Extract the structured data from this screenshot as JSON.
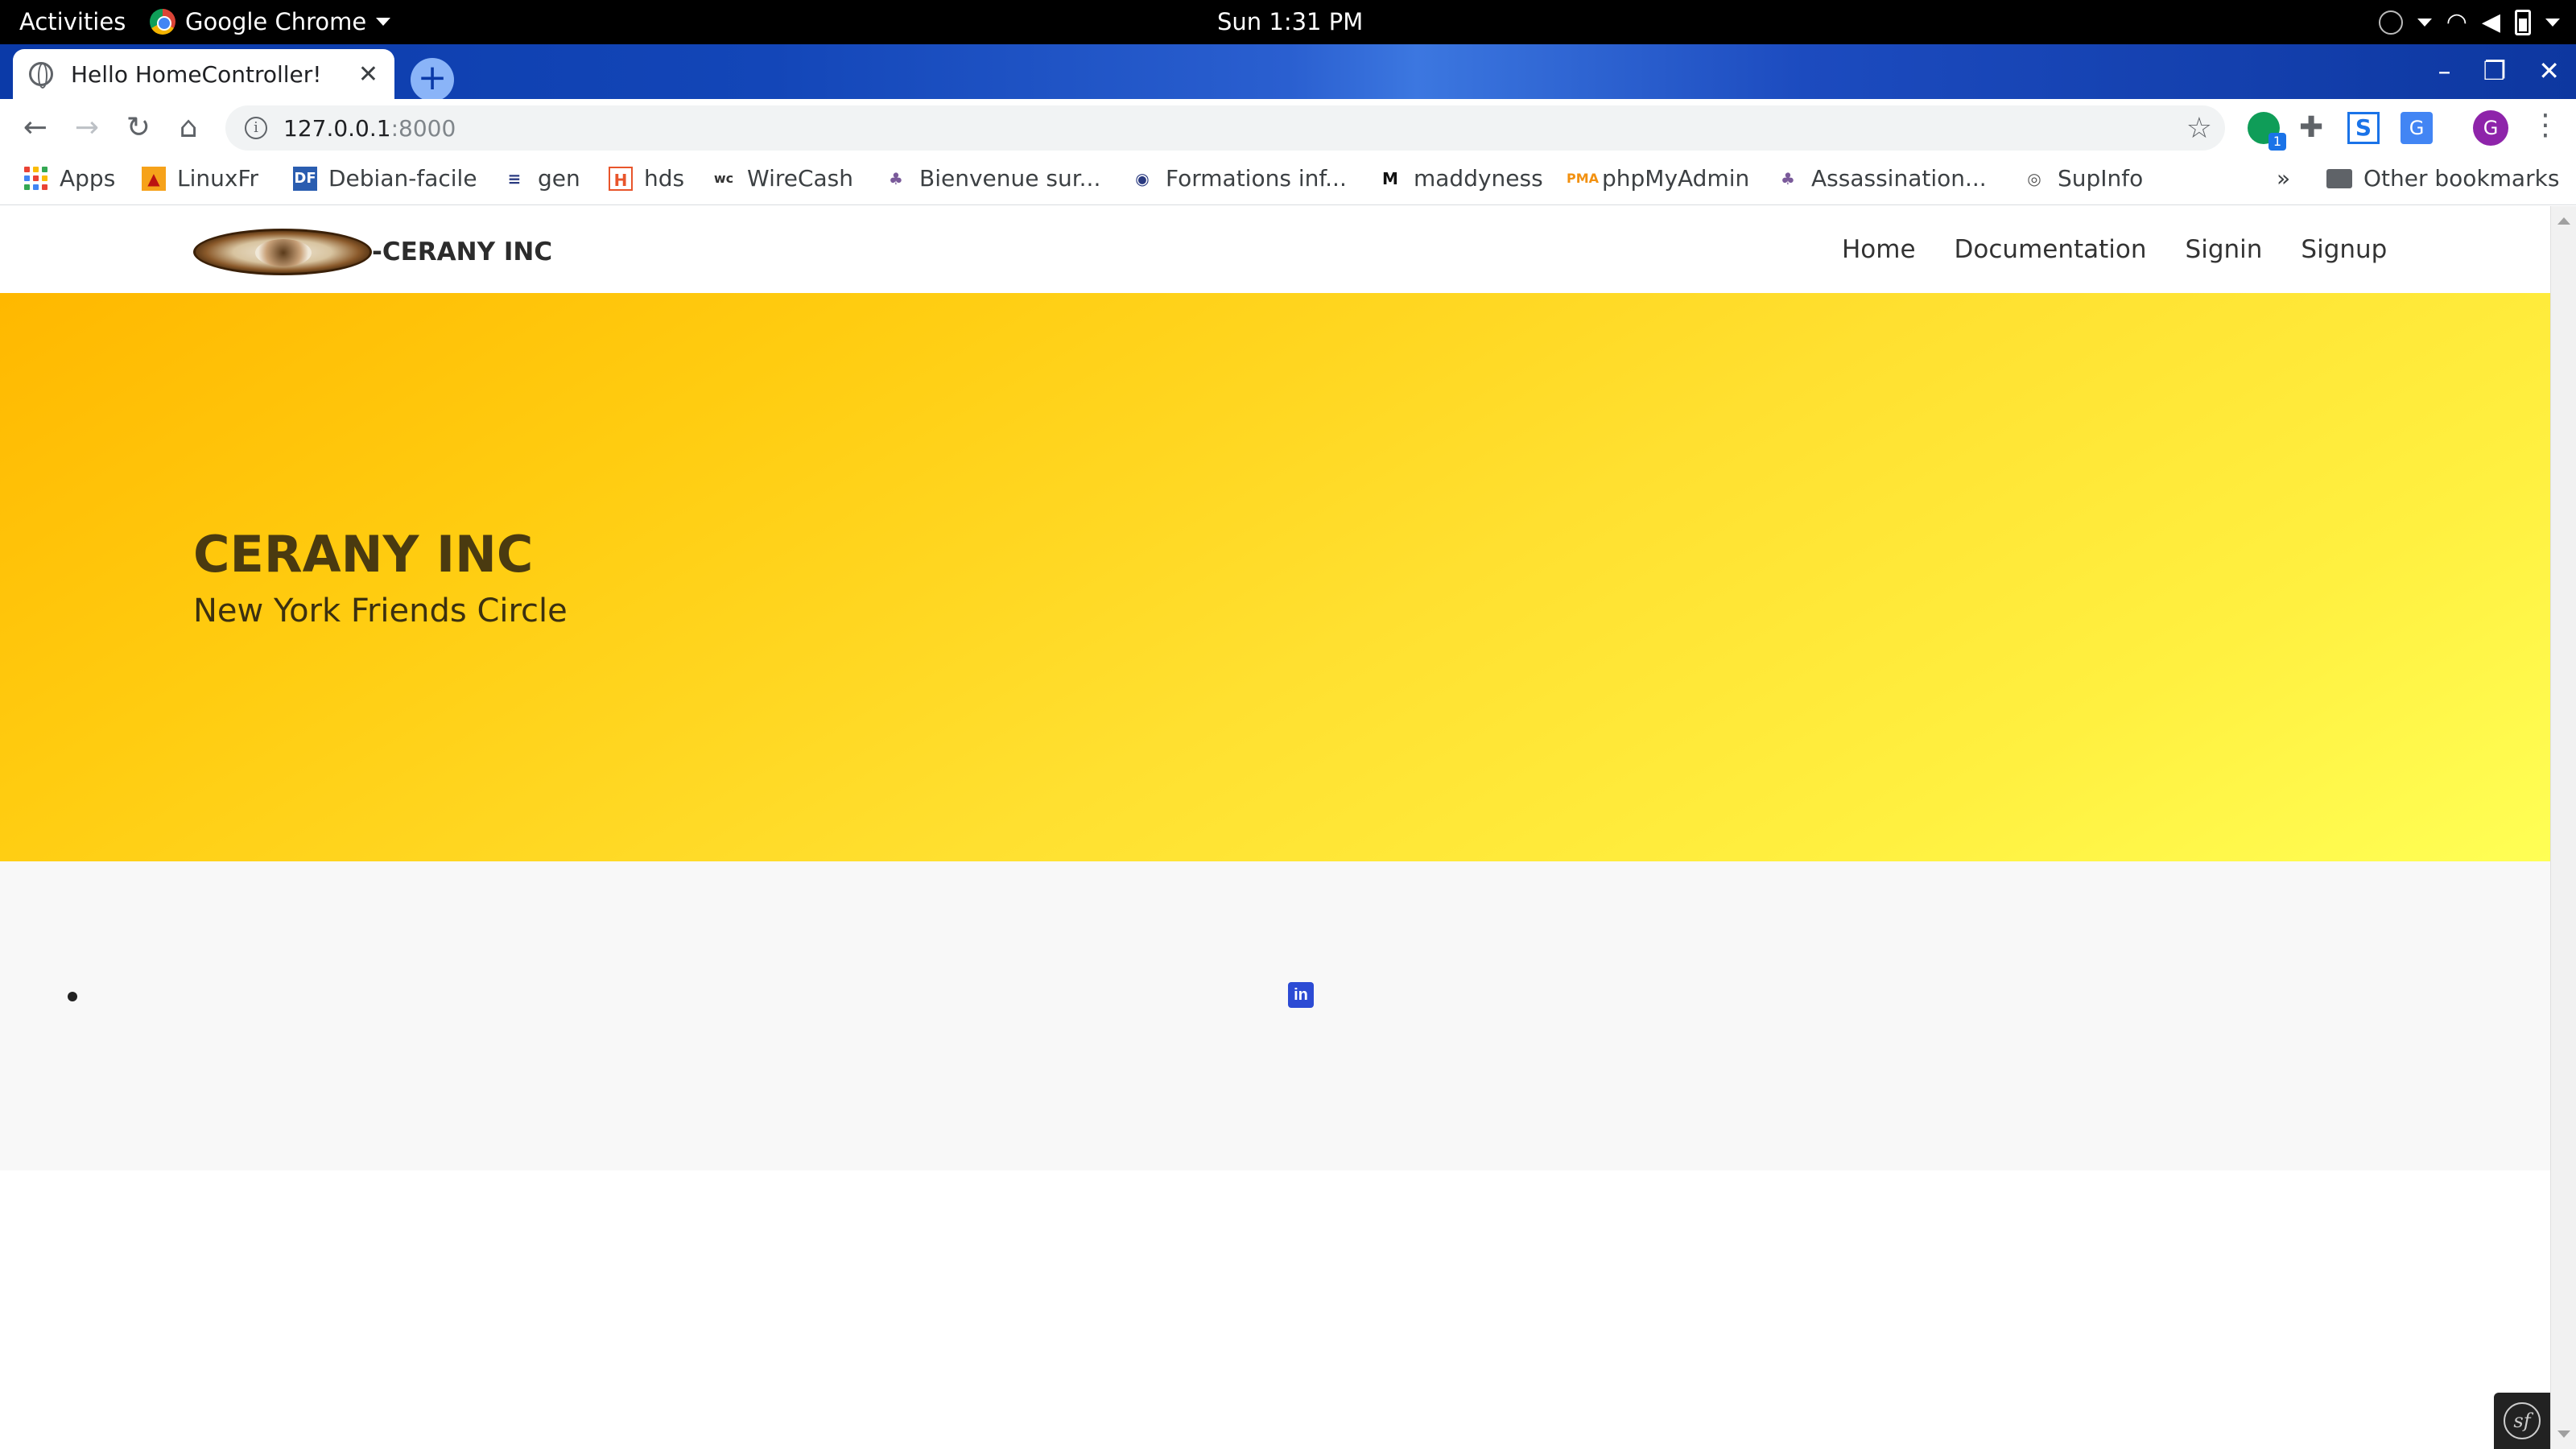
{
  "system_bar": {
    "activities": "Activities",
    "app_name": "Google Chrome",
    "clock": "Sun  1:31 PM"
  },
  "browser": {
    "tab_title": "Hello HomeController!",
    "url_host": "127.0.0.1",
    "url_port": ":8000",
    "profile_initial": "G",
    "extension_badge": "1",
    "bookmarks": [
      {
        "label": "Apps",
        "icon": "apps-grid-icon"
      },
      {
        "label": "LinuxFr",
        "icon": "linuxfr-icon"
      },
      {
        "label": "Debian-facile",
        "icon": "debian-facile-icon"
      },
      {
        "label": "gen",
        "icon": "gen-icon"
      },
      {
        "label": "hds",
        "icon": "hds-icon"
      },
      {
        "label": "WireCash",
        "icon": "wirecash-icon"
      },
      {
        "label": "Bienvenue sur...",
        "icon": "bienvenue-icon"
      },
      {
        "label": "Formations inf...",
        "icon": "formations-icon"
      },
      {
        "label": "maddyness",
        "icon": "maddyness-icon"
      },
      {
        "label": "phpMyAdmin",
        "icon": "phpmyadmin-icon"
      },
      {
        "label": "Assassination...",
        "icon": "assassination-icon"
      },
      {
        "label": "SupInfo",
        "icon": "supinfo-icon"
      }
    ],
    "overflow": "»",
    "other_bookmarks": "Other bookmarks"
  },
  "site": {
    "brand": "-CERANY INC",
    "nav": [
      "Home",
      "Documentation",
      "Signin",
      "Signup"
    ],
    "hero_title": "CERANY INC",
    "hero_subtitle": "New York Friends Circle",
    "linkedin_glyph": "in",
    "symfony_glyph": "sf"
  },
  "colors": {
    "hero_start": "#ffb800",
    "hero_end": "#ffff55",
    "tabstrip": "#1346b8",
    "linkedin": "#2c4bd4"
  }
}
